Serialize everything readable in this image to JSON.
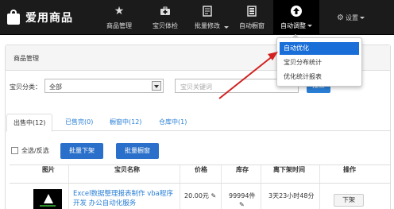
{
  "brand": {
    "name": "爱用商品"
  },
  "nav": [
    {
      "label": "商品管理",
      "icon": "star-icon"
    },
    {
      "label": "宝贝体检",
      "icon": "medkit-icon"
    },
    {
      "label": "批量修改",
      "icon": "edit-doc-icon"
    },
    {
      "label": "自动橱窗",
      "icon": "list-icon"
    },
    {
      "label": "自动调整",
      "icon": "up-arrow-circle-icon",
      "active": true
    }
  ],
  "settings": {
    "label": "设置"
  },
  "panel": {
    "title": "商品管理"
  },
  "filter": {
    "category_label": "宝贝分类：",
    "category_value": "全部",
    "search_placeholder": "宝贝关键词",
    "search_button": "搜索"
  },
  "tabs": [
    "出售中(12)",
    "已售完(0)",
    "橱窗中(12)",
    "仓库中(1)"
  ],
  "actions": {
    "select_all": "全选/反选",
    "batch_off_shelf": "批量下架",
    "batch_window": "批量橱窗"
  },
  "table": {
    "headers": [
      "图片",
      "宝贝名称",
      "价格",
      "库存",
      "离下架时间",
      "操作"
    ],
    "rows": [
      {
        "name": "Excel数据整理报表制作 vba程序开发 办公自动化服务",
        "price": "20.00元",
        "stock": "99994件",
        "time_left": "3天23小时48分",
        "action": "下架"
      }
    ]
  },
  "dropdown": {
    "items": [
      "自动优化",
      "宝贝分布统计",
      "优化统计报表"
    ],
    "highlighted_index": 0
  },
  "colors": {
    "accent": "#1a6ed8",
    "topbar": "#1b1b1b",
    "annotation_arrow": "#d32020"
  }
}
